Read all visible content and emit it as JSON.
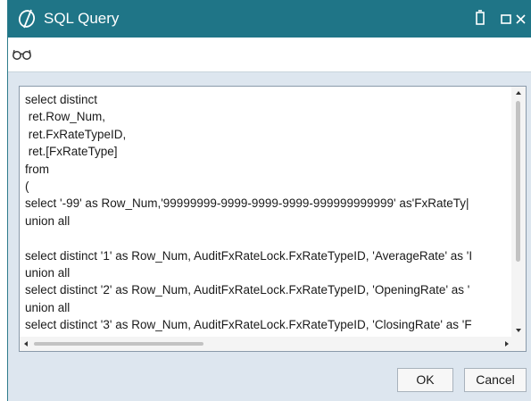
{
  "window": {
    "title": "SQL Query"
  },
  "toolbar": {
    "icon": "glasses-icon"
  },
  "editor": {
    "lines": [
      "select distinct",
      " ret.Row_Num,",
      " ret.FxRateTypeID,",
      " ret.[FxRateType]",
      "from",
      "(",
      "select '-99' as Row_Num,'99999999-9999-9999-9999-999999999999' as'FxRateTy|",
      "union all",
      "",
      "select distinct '1' as Row_Num, AuditFxRateLock.FxRateTypeID, 'AverageRate' as 'I",
      "union all",
      "select distinct '2' as Row_Num, AuditFxRateLock.FxRateTypeID, 'OpeningRate' as '",
      "union all",
      "select distinct '3' as Row_Num, AuditFxRateLock.FxRateTypeID, 'ClosingRate' as 'F"
    ]
  },
  "buttons": {
    "ok": "OK",
    "cancel": "Cancel"
  },
  "colors": {
    "titlebar": "#1f7587",
    "content_bg": "#dde6ef"
  }
}
